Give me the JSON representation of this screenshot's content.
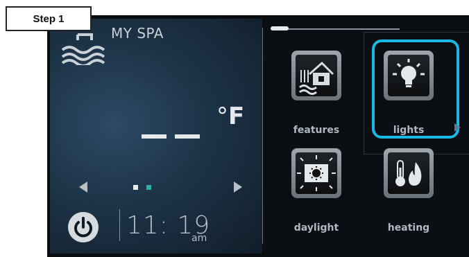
{
  "step_label": "Step 1",
  "app_title": "MY SPA",
  "temperature": {
    "value": "— —",
    "unit_degree": "°",
    "unit_letter": "F"
  },
  "clock": {
    "time": "11: 19",
    "ampm": "am"
  },
  "pager": {
    "pages": 2,
    "active_page": 2,
    "active_color": "#1fb7a8"
  },
  "tiles": [
    {
      "label": "features",
      "icon": "house-with-water-icon"
    },
    {
      "label": "lights",
      "icon": "light-bulb-icon",
      "highlighted": true
    },
    {
      "label": "daylight",
      "icon": "sun-icon"
    },
    {
      "label": "heating",
      "icon": "thermometer-flame-icon"
    }
  ],
  "colors": {
    "highlight": "#19b9e6",
    "panel_background": "#1d3347"
  }
}
